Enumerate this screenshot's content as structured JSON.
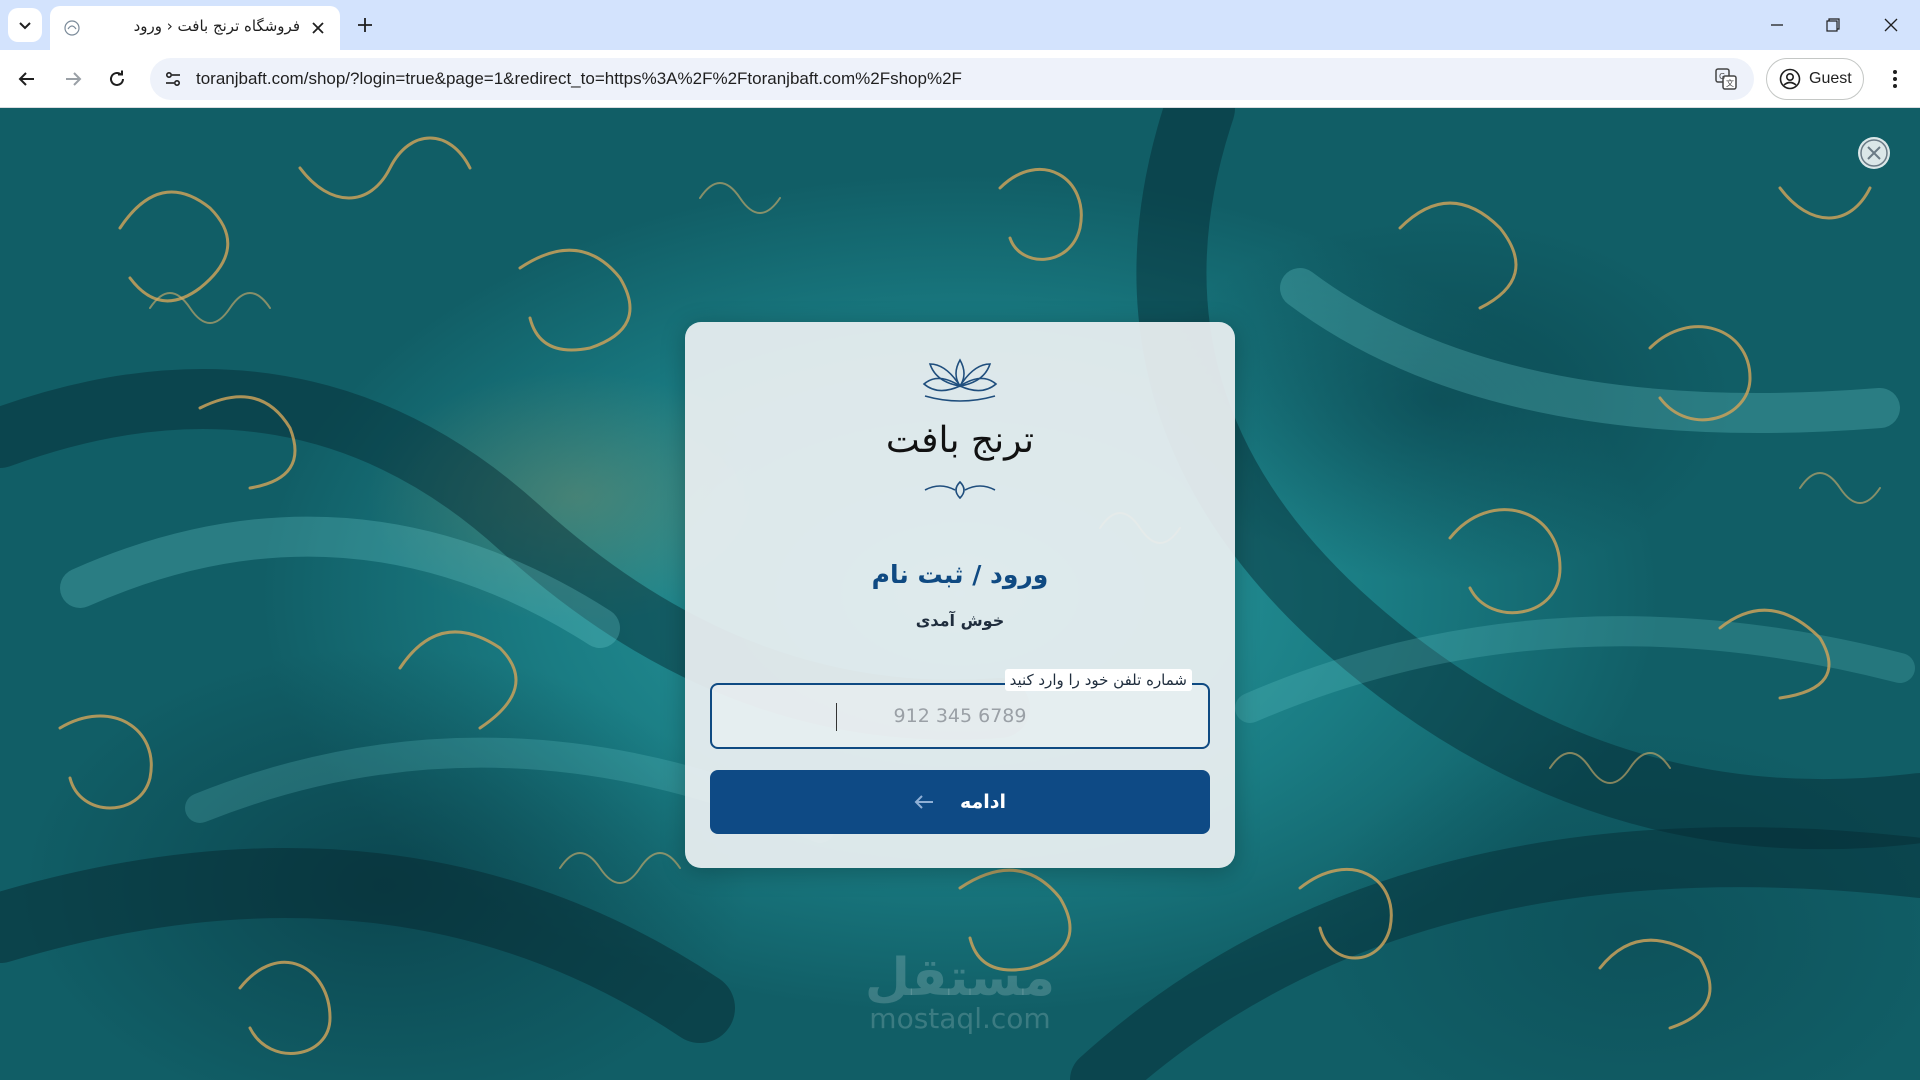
{
  "browser": {
    "tab_title": "فروشگاه ترنج بافت ‹ ورود",
    "url": "toranjbaft.com/shop/?login=true&page=1&redirect_to=https%3A%2F%2Ftoranjbaft.com%2Fshop%2F",
    "profile_label": "Guest",
    "icons": [
      "tab-search-icon",
      "favicon",
      "close-icon",
      "plus-icon",
      "minimize-icon",
      "restore-icon",
      "back-icon",
      "forward-icon",
      "reload-icon",
      "site-info-icon",
      "translate-icon",
      "profile-icon",
      "more-vert-icon"
    ]
  },
  "modal": {
    "logo_text": "ترنج بافت",
    "title": "ورود / ثبت نام",
    "subtitle": "خوش آمدی",
    "phone": {
      "label": "شماره تلفن خود را وارد کنید",
      "placeholder": "912 345 6789",
      "value": ""
    },
    "continue_label": "ادامه"
  },
  "watermark": {
    "arabic": "مستقل",
    "latin": "mostaql.com"
  },
  "colors": {
    "primary": "#0e4a85",
    "tabbar": "#d3e3fd",
    "fabric_teal": "#1f8f95",
    "ornament_gold": "#c9a15a"
  }
}
